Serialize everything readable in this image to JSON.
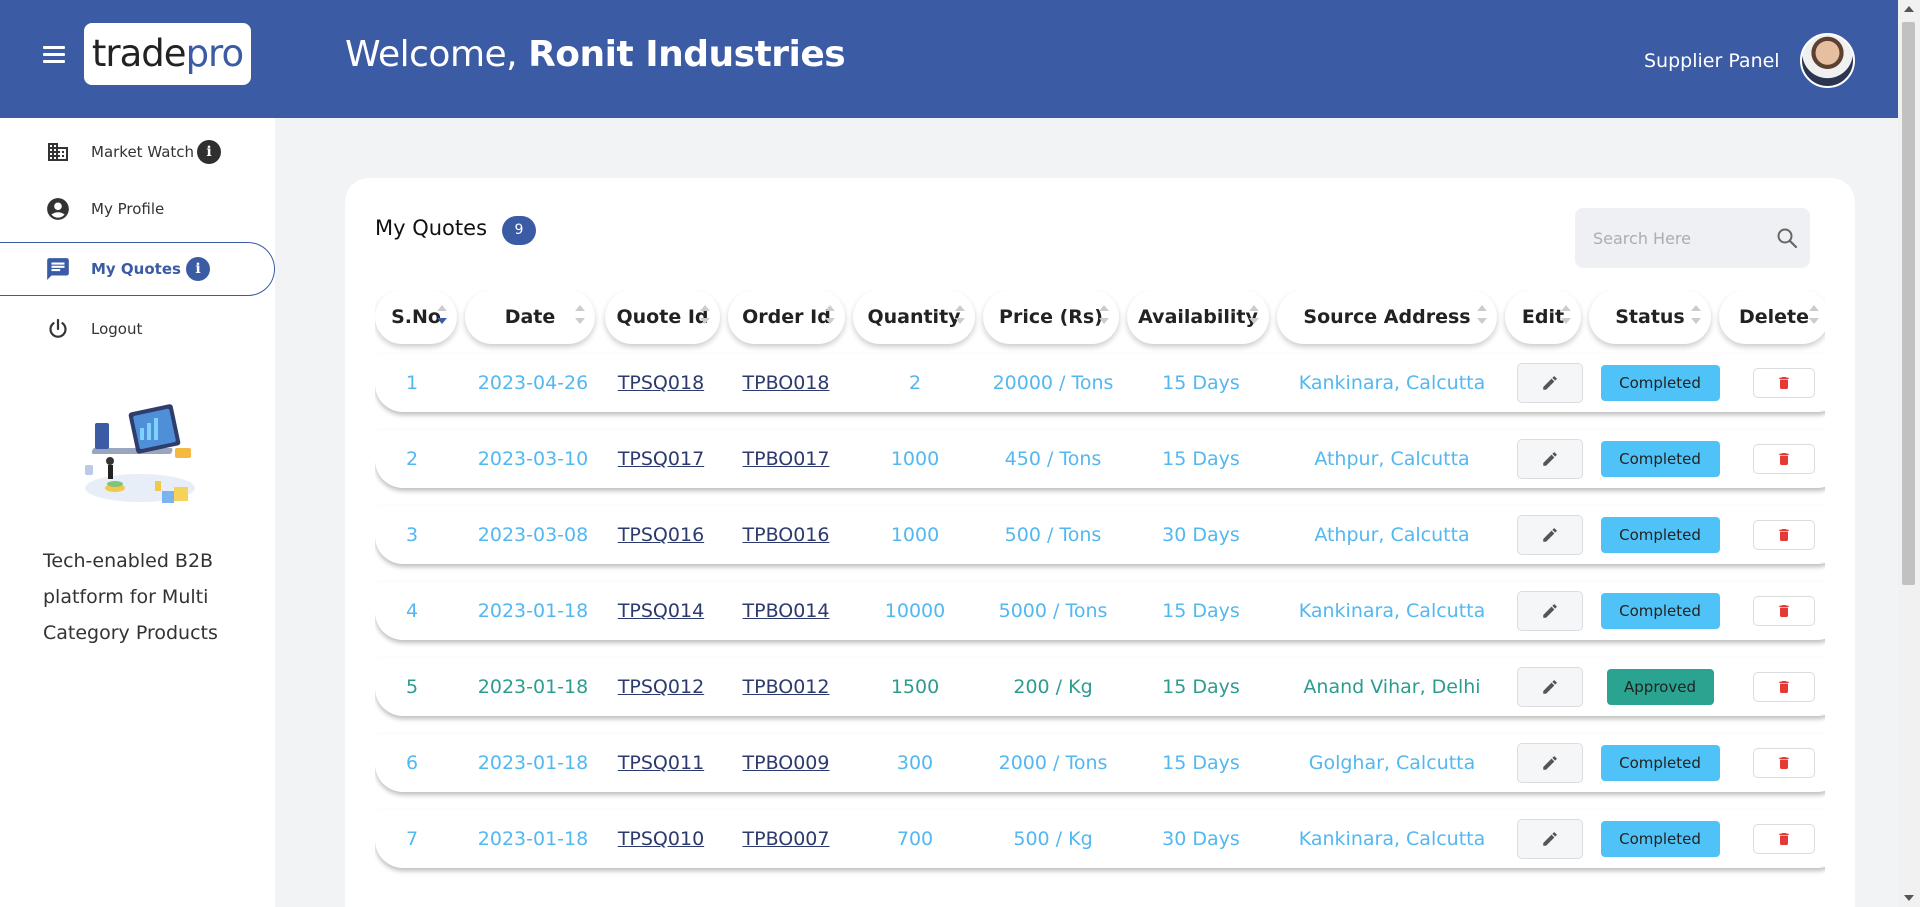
{
  "header": {
    "logo_part1": "trade",
    "logo_part2": "pro",
    "welcome_prefix": "Welcome, ",
    "company_name": "Ronit Industries",
    "panel_label": "Supplier Panel",
    "accent_color": "#3c5ba5"
  },
  "sidebar": {
    "items": [
      {
        "label": "Market Watch",
        "icon": "building-icon"
      },
      {
        "label": "My Profile",
        "icon": "account-circle-icon"
      },
      {
        "label": "My Quotes",
        "icon": "chat-icon"
      },
      {
        "label": "Logout",
        "icon": "power-icon"
      }
    ],
    "tagline": "Tech-enabled B2B platform for Multi Category Products"
  },
  "quotes": {
    "title": "My Quotes",
    "count": "9",
    "search_placeholder": "Search Here",
    "columns": [
      "S.No",
      "Date",
      "Quote Id",
      "Order Id",
      "Quantity",
      "Price (Rs)",
      "Availability",
      "Source Address",
      "Edit",
      "Status",
      "Delete"
    ],
    "rows": [
      {
        "sno": "1",
        "date": "2023-04-26",
        "quote_id": "TPSQ018",
        "order_id": "TPBO018",
        "quantity": "2",
        "price": "20000 / Tons",
        "availability": "15 Days",
        "address": "Kankinara, Calcutta",
        "status": "Completed"
      },
      {
        "sno": "2",
        "date": "2023-03-10",
        "quote_id": "TPSQ017",
        "order_id": "TPBO017",
        "quantity": "1000",
        "price": "450 / Tons",
        "availability": "15 Days",
        "address": "Athpur, Calcutta",
        "status": "Completed"
      },
      {
        "sno": "3",
        "date": "2023-03-08",
        "quote_id": "TPSQ016",
        "order_id": "TPBO016",
        "quantity": "1000",
        "price": "500 / Tons",
        "availability": "30 Days",
        "address": "Athpur, Calcutta",
        "status": "Completed"
      },
      {
        "sno": "4",
        "date": "2023-01-18",
        "quote_id": "TPSQ014",
        "order_id": "TPBO014",
        "quantity": "10000",
        "price": "5000 / Tons",
        "availability": "15 Days",
        "address": "Kankinara, Calcutta",
        "status": "Completed"
      },
      {
        "sno": "5",
        "date": "2023-01-18",
        "quote_id": "TPSQ012",
        "order_id": "TPBO012",
        "quantity": "1500",
        "price": "200 / Kg",
        "availability": "15 Days",
        "address": "Anand Vihar, Delhi",
        "status": "Approved"
      },
      {
        "sno": "6",
        "date": "2023-01-18",
        "quote_id": "TPSQ011",
        "order_id": "TPBO009",
        "quantity": "300",
        "price": "2000 / Tons",
        "availability": "15 Days",
        "address": "Golghar, Calcutta",
        "status": "Completed"
      },
      {
        "sno": "7",
        "date": "2023-01-18",
        "quote_id": "TPSQ010",
        "order_id": "TPBO007",
        "quantity": "700",
        "price": "500 / Kg",
        "availability": "30 Days",
        "address": "Kankinara, Calcutta",
        "status": "Completed"
      }
    ],
    "status_colors": {
      "Completed": "#4fc3f7",
      "Approved": "#2aa391"
    }
  }
}
